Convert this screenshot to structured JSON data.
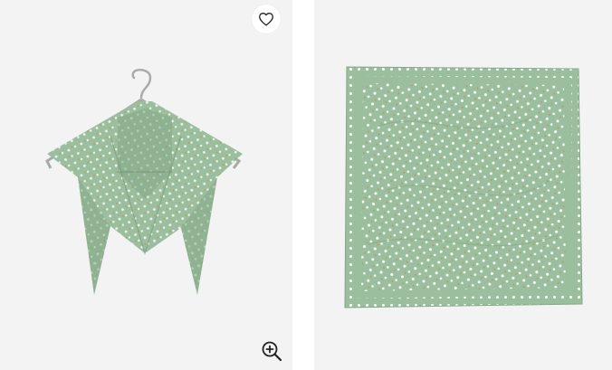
{
  "gallery": {
    "images": [
      {
        "alt": "",
        "subject": "bandana-on-hanger"
      },
      {
        "alt": "",
        "subject": "bandana-flat"
      }
    ],
    "favorite": {
      "icon": "heart-icon"
    },
    "zoom": {
      "icon": "zoom-in-icon"
    }
  },
  "colors": {
    "panel_background": "#f3f3f3",
    "fabric_green": "#9bbf9e",
    "fabric_green_dark": "#84a886",
    "dot_white": "#ffffff",
    "dot_gold": "#b99548",
    "hanger": "#a9a9a9",
    "icon": "#222222"
  }
}
